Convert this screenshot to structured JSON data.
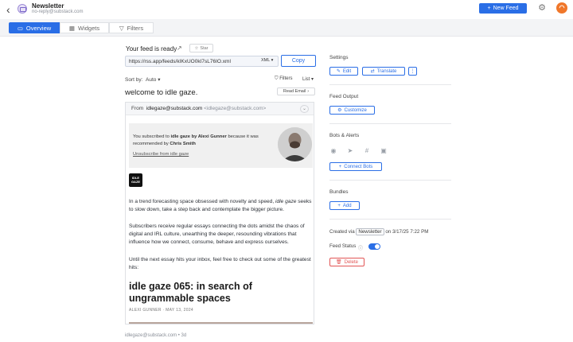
{
  "header": {
    "title": "Newsletter",
    "subtitle": "no-reply@substack.com",
    "new_feed_label": "New Feed",
    "back_icon": "chevron-left-icon",
    "settings_icon": "gear-icon",
    "rss_icon": "rss-icon"
  },
  "tabs": [
    {
      "label": "Overview",
      "active": true
    },
    {
      "label": "Widgets",
      "active": false
    },
    {
      "label": "Filters",
      "active": false
    }
  ],
  "feed": {
    "ready_text": "Your feed is ready",
    "star_label": "Star",
    "url": "https://rss.app/feeds/kIKxUO0kI7sL76IO.xml",
    "format": "XML",
    "copy_label": "Copy",
    "sort_label": "Sort by:",
    "sort_value": "Auto",
    "filters_label": "Filters",
    "list_label": "List"
  },
  "post": {
    "title": "welcome to idle gaze.",
    "read_email_label": "Read Email",
    "from_label": "From",
    "from_name": "idlegaze@substack.com",
    "from_address": "<idlegaze@substack.com>",
    "subscribe_pre": "You subscribed to ",
    "subscribe_pub": "idle gaze by Alexi Gunner",
    "subscribe_mid": " because it was recommended by ",
    "subscribe_rec": "Chris Smith",
    "unsubscribe": "Unsubscribe from idle gaze",
    "logo_text": "IDLE GAZE",
    "para1_a": "In a trend forecasting space obsessed with novelty and speed, ",
    "para1_em": "idle gaze",
    "para1_b": " seeks to slow down, take a step back and contemplate the bigger picture.",
    "para2": "Subscribers receive regular essays connecting the dots amidst the chaos of digital and IRL culture, unearthing the deeper, resounding vibrations that influence how we connect, consume, behave and express ourselves.",
    "para3": "Until the next essay hits your inbox, feel free to check out some of the greatest hits:",
    "essay_title": "idle gaze 065: in search of ungrammable spaces",
    "essay_meta": "ALEXI GUNNER · MAY 13, 2024",
    "footer": "idlegaze@substack.com  •  3d"
  },
  "sidebar": {
    "settings_heading": "Settings",
    "edit_label": "Edit",
    "translate_label": "Translate",
    "more_label": "⋮",
    "feed_output_heading": "Feed Output",
    "customize_label": "Customize",
    "bots_heading": "Bots & Alerts",
    "bot_icons": [
      "discord-icon",
      "telegram-icon",
      "slack-icon",
      "teams-icon"
    ],
    "connect_bots_label": "Connect Bots",
    "bundles_heading": "Bundles",
    "add_label": "Add",
    "created_pre": "Created via",
    "created_chip": "Newsletter",
    "created_post": "on 3/17/25 7:22 PM",
    "feed_status_label": "Feed Status",
    "feed_status_on": true,
    "delete_label": "Delete"
  },
  "colors": {
    "accent": "#2a6ee6",
    "danger": "#e25555",
    "rss": "#f0772a"
  }
}
